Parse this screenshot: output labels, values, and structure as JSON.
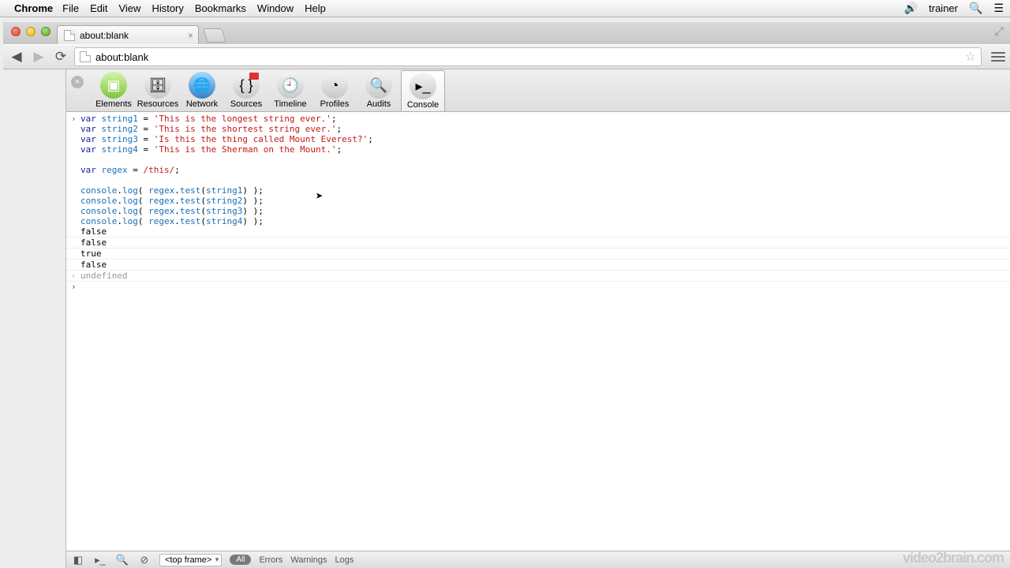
{
  "menubar": {
    "app": "Chrome",
    "items": [
      "File",
      "Edit",
      "View",
      "History",
      "Bookmarks",
      "Window",
      "Help"
    ],
    "user": "trainer"
  },
  "tab": {
    "title": "about:blank"
  },
  "omnibox": {
    "url": "about:blank"
  },
  "devtools": {
    "tabs": [
      "Elements",
      "Resources",
      "Network",
      "Sources",
      "Timeline",
      "Profiles",
      "Audits",
      "Console"
    ],
    "active": "Console"
  },
  "console": {
    "code": [
      "var string1 = 'This is the longest string ever.';",
      "var string2 = 'This is the shortest string ever.';",
      "var string3 = 'Is this the thing called Mount Everest?';",
      "var string4 = 'This is the Sherman on the Mount.';",
      "",
      "var regex = /this/;",
      "",
      "console.log( regex.test(string1) );",
      "console.log( regex.test(string2) );",
      "console.log( regex.test(string3) );",
      "console.log( regex.test(string4) );"
    ],
    "output": [
      "false",
      "false",
      "true",
      "false"
    ],
    "return": "undefined"
  },
  "bottombar": {
    "frame": "<top frame>",
    "filter_all": "All",
    "filters": [
      "Errors",
      "Warnings",
      "Logs"
    ]
  },
  "watermark": "video2brain.com"
}
